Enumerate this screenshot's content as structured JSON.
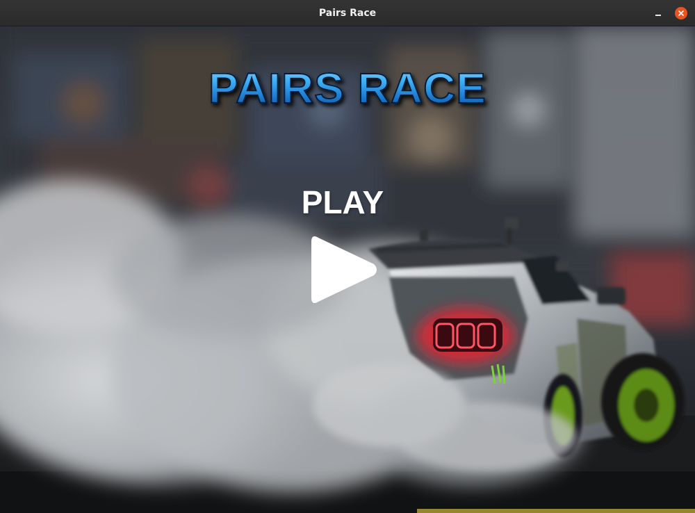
{
  "window": {
    "title": "Pairs Race",
    "controls": {
      "minimize": "minimize-icon",
      "close": "close-icon",
      "close_color": "#e95420"
    }
  },
  "menu": {
    "logo_text": "PAIRS RACE",
    "logo_color": "#3fb0f6",
    "play_label": "PLAY",
    "play_icon": "play-icon"
  },
  "background": {
    "scene": "drifting-car-smoke-icon",
    "taillight_color": "#ff2a3a",
    "wheel_color": "#6a9a1a"
  }
}
